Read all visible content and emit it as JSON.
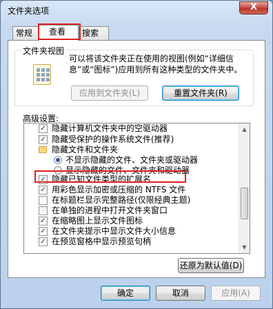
{
  "window": {
    "title": "文件夹选项",
    "close": "X"
  },
  "tabs": [
    {
      "label": "常规"
    },
    {
      "label": "查看"
    },
    {
      "label": "搜索"
    }
  ],
  "folder_view": {
    "title": "文件夹视图",
    "description": "可以将该文件夹正在使用的视图(例如“详细信息”或“图标”)应用到所有这种类型的文件夹中。",
    "apply_label": "应用到文件夹(L)",
    "reset_label": "重置文件夹(R)"
  },
  "advanced": {
    "label": "高级设置:",
    "items": [
      {
        "text": "隐藏计算机文件夹中的空驱动器",
        "type": "checkbox",
        "checked": true
      },
      {
        "text": "隐藏受保护的操作系统文件(推荐)",
        "type": "checkbox",
        "checked": true
      },
      {
        "text": "隐藏文件和文件夹",
        "type": "folder"
      },
      {
        "text": "不显示隐藏的文件、文件夹或驱动器",
        "type": "radio",
        "checked": true
      },
      {
        "text": "显示隐藏的文件、文件夹和驱动器",
        "type": "radio",
        "checked": false
      },
      {
        "text": "隐藏已知文件类型的扩展名",
        "type": "checkbox",
        "checked": true
      },
      {
        "text": "用彩色显示加密或压缩的 NTFS 文件",
        "type": "checkbox",
        "checked": true
      },
      {
        "text": "在标题栏显示完整路径(仅限经典主题)",
        "type": "checkbox",
        "checked": false
      },
      {
        "text": "在单独的进程中打开文件夹窗口",
        "type": "checkbox",
        "checked": false
      },
      {
        "text": "在缩略图上显示文件图标",
        "type": "checkbox",
        "checked": true
      },
      {
        "text": "在文件夹提示中显示文件大小信息",
        "type": "checkbox",
        "checked": true
      },
      {
        "text": "在预览窗格中显示预览句柄",
        "type": "checkbox",
        "checked": true
      }
    ],
    "restore_label": "还原为默认值(D)"
  },
  "footer": {
    "ok": "确定",
    "cancel": "取消",
    "apply": "应用(A)"
  },
  "colors": {
    "highlight": "#e02020",
    "checkmark": "#1c3d6b"
  }
}
